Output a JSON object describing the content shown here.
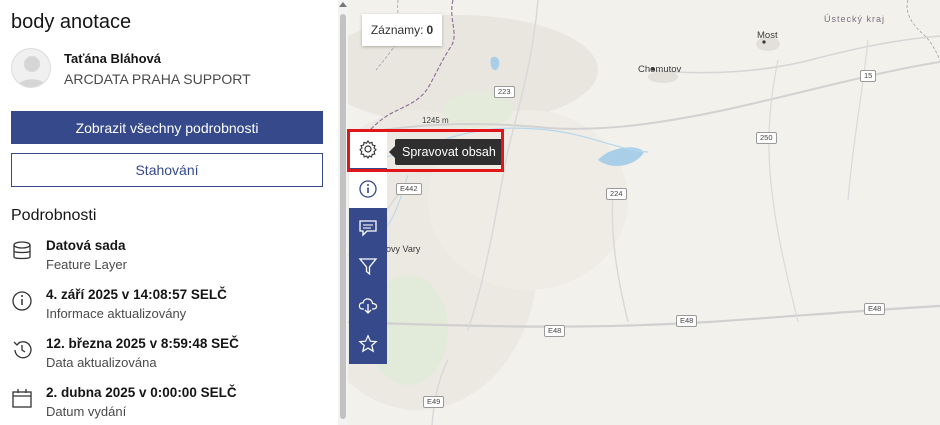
{
  "panel": {
    "title": "body anotace",
    "owner": {
      "name": "Taťána Bláhová",
      "organization": "ARCDATA PRAHA SUPPORT"
    },
    "buttons": {
      "view_details": "Zobrazit všechny podrobnosti",
      "download": "Stahování"
    },
    "details_heading": "Podrobnosti",
    "details": [
      {
        "icon": "database-icon",
        "title": "Datová sada",
        "subtitle": "Feature Layer"
      },
      {
        "icon": "info-icon",
        "title": "4. září 2025 v 14:08:57 SELČ",
        "subtitle": "Informace aktualizovány"
      },
      {
        "icon": "history-icon",
        "title": "12. března 2025 v 8:59:48 SEČ",
        "subtitle": "Data aktualizována"
      },
      {
        "icon": "calendar-icon",
        "title": "2. dubna 2025 v 0:00:00 SELČ",
        "subtitle": "Datum vydání"
      }
    ]
  },
  "map": {
    "records": {
      "label": "Záznamy:",
      "count": "0"
    },
    "labels": {
      "region": "Ústecký kraj",
      "most": "Most",
      "chomutov": "Chomutov",
      "vary": "ovy Vary",
      "elevation": "1245 m"
    },
    "roads": {
      "r223": "223",
      "r15": "15",
      "r250": "250",
      "r224": "224",
      "e442": "E442",
      "e48a": "E48",
      "e48b": "E48",
      "e48c": "E48",
      "e49": "E49"
    },
    "tooltip": "Spravovat obsah",
    "tools": [
      "gear-icon",
      "info-icon",
      "comment-icon",
      "filter-icon",
      "cloud-download-icon",
      "star-icon"
    ],
    "colors": {
      "toolbar": "#35498b",
      "highlight": "#e0161b",
      "border": "#8c6a9a",
      "water": "#a9cfe8"
    }
  }
}
